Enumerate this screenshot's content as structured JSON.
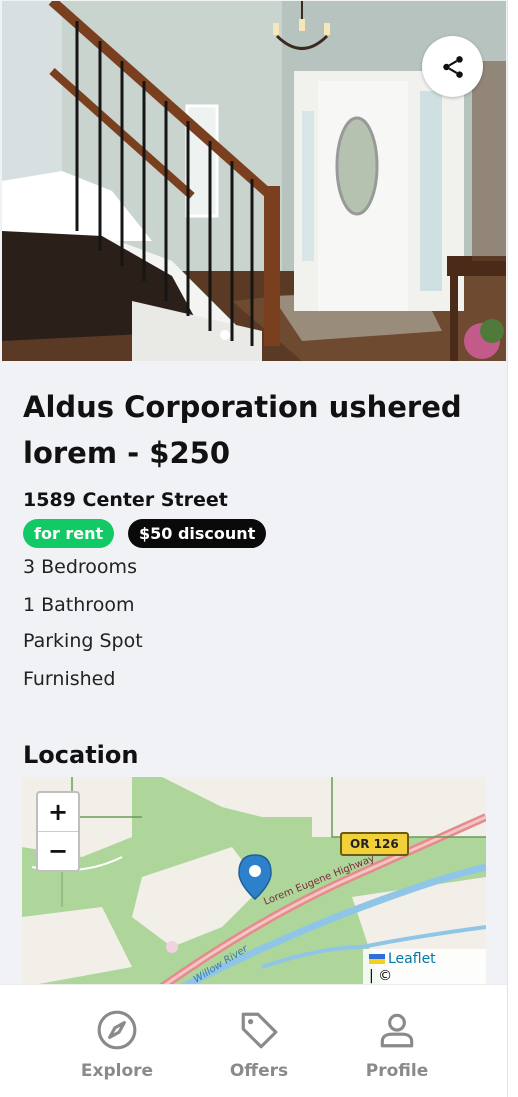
{
  "listing": {
    "title": "Aldus Corporation ushered lorem - $250",
    "address": "1589 Center Street",
    "badges": {
      "rent": "for rent",
      "discount": "$50 discount"
    },
    "features": [
      "3 Bedrooms",
      "1 Bathroom",
      "Parking Spot",
      "Furnished"
    ]
  },
  "location": {
    "heading": "Location",
    "map": {
      "zoom_in": "+",
      "zoom_out": "−",
      "route_label": "OR 126",
      "road_label": "Lorem Eugene Highway",
      "river_label": "Willow River",
      "attribution_link": "Leaflet",
      "attribution_text": "| ©"
    }
  },
  "icons": {
    "share": "share-icon",
    "explore": "compass-icon",
    "offers": "tag-icon",
    "profile": "user-icon"
  },
  "nav": {
    "explore": "Explore",
    "offers": "Offers",
    "profile": "Profile"
  },
  "colors": {
    "rent_badge": "#13c965",
    "discount_badge": "#0a0a0a",
    "nav_icon": "#8a8a8a",
    "background": "#f1f2f6"
  }
}
